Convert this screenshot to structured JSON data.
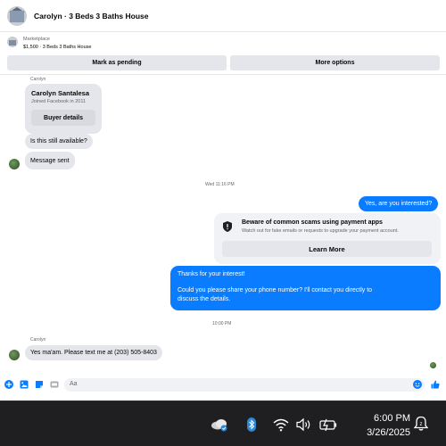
{
  "header": {
    "title": "Carolyn · 3 Beds 3 Baths House"
  },
  "marketplace": {
    "label": "Marketplace",
    "listing": "$1,500 · 3 Beds 3 Baths House",
    "pending_button": "Mark as pending",
    "more_button": "More options"
  },
  "thread": {
    "sender_top": "Carolyn",
    "profile_card": {
      "name": "Carolyn Santalesa",
      "joined": "Joined Facebook in 2011",
      "button": "Buyer details"
    },
    "msg_available": "Is this still available?",
    "msg_sent": "Message sent",
    "timestamp_1": "Wed 11:16 PM",
    "out_interested": "Yes, are you interested?",
    "scam_notice": {
      "title": "Beware of common scams using payment apps",
      "text": "Watch out for fake emails or requests to upgrade your payment account.",
      "button": "Learn More"
    },
    "out_long": {
      "line1": "Thanks for your interest!",
      "line2": "Could you please share your phone number? I'll contact you directly to",
      "line3": "discuss the details."
    },
    "timestamp_2": "10:00 PM",
    "sender_bottom": "Carolyn",
    "msg_phone": "Yes ma'am. Please text me at (203) 505-8403"
  },
  "composer": {
    "placeholder": "Aa",
    "icons": [
      "plus-circle-icon",
      "photo-icon",
      "sticker-icon",
      "gif-icon",
      "emoji-icon",
      "thumbs-up-icon"
    ]
  },
  "taskbar": {
    "time": "6:00 PM",
    "date": "3/26/2025",
    "icons": [
      "onedrive-icon",
      "bluetooth-icon",
      "wifi-icon",
      "volume-icon",
      "battery-icon",
      "notification-icon"
    ]
  },
  "colors": {
    "accent": "#0a7cff",
    "bubble_in": "#e4e6eb",
    "taskbar": "#1f1f22"
  }
}
